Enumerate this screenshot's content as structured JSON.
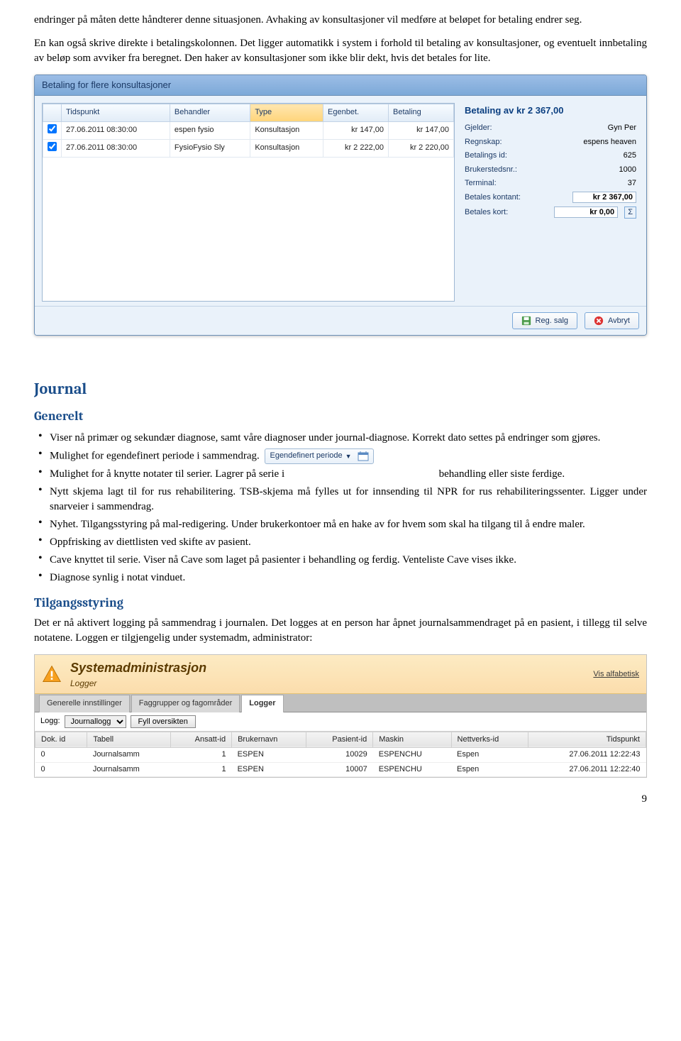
{
  "para1": "endringer på måten dette håndterer denne situasjonen. Avhaking av konsultasjoner vil medføre at beløpet for betaling endrer seg.",
  "para2": "En kan også skrive direkte i betalingskolonnen.",
  "para3": "Det ligger automatikk i system i forhold til betaling av konsultasjoner, og eventuelt innbetaling av beløp som avviker fra beregnet. Den haker av konsultasjoner som ikke blir dekt, hvis det betales for lite.",
  "dialog": {
    "title": "Betaling for flere konsultasjoner",
    "cols": {
      "tids": "Tidspunkt",
      "beh": "Behandler",
      "type": "Type",
      "egen": "Egenbet.",
      "bet": "Betaling"
    },
    "rows": [
      {
        "tids": "27.06.2011 08:30:00",
        "beh": "espen fysio",
        "type": "Konsultasjon",
        "egen": "kr 147,00",
        "bet": "kr 147,00"
      },
      {
        "tids": "27.06.2011 08:30:00",
        "beh": "FysioFysio Sly",
        "type": "Konsultasjon",
        "egen": "kr 2 222,00",
        "bet": "kr 2 220,00"
      }
    ],
    "side": {
      "title": "Betaling av kr 2 367,00",
      "gjelder_k": "Gjelder:",
      "gjelder_v": "Gyn Per",
      "regnskap_k": "Regnskap:",
      "regnskap_v": "espens heaven",
      "betid_k": "Betalings id:",
      "betid_v": "625",
      "bruker_k": "Brukerstedsnr.:",
      "bruker_v": "1000",
      "term_k": "Terminal:",
      "term_v": "37",
      "kontant_k": "Betales kontant:",
      "kontant_v": "kr 2 367,00",
      "kort_k": "Betales kort:",
      "kort_v": "kr 0,00"
    },
    "footer": {
      "reg": "Reg. salg",
      "avbryt": "Avbryt"
    }
  },
  "journal": {
    "heading": "Journal",
    "generelt": "Generelt",
    "b1a": "Viser nå primær og sekundær diagnose, samt våre diagnoser under journal-diagnose. Korrekt dato settes på endringer som gjøres.",
    "b2": "Mulighet for egendefinert periode i sammendrag.",
    "eg_label": "Egendefinert periode",
    "b3a": "Mulighet for å knytte notater til serier. Lagrer på serie i",
    "b3b": "behandling eller siste ferdige.",
    "b4": "Nytt skjema lagt til for rus rehabilitering. TSB-skjema må fylles ut for innsending til NPR for rus rehabiliteringssenter. Ligger under snarveier i sammendrag.",
    "b5": "Nyhet. Tilgangsstyring på mal-redigering. Under brukerkontoer må en hake av for hvem som skal ha tilgang til å endre maler.",
    "b6": "Oppfrisking av diettlisten ved skifte av pasient.",
    "b7": "Cave knyttet til serie. Viser nå Cave som laget på pasienter i behandling og ferdig. Venteliste Cave vises ikke.",
    "b8": "Diagnose synlig i notat vinduet."
  },
  "tilgang": {
    "heading": "Tilgangsstyring",
    "p": "Det er nå aktivert logging på sammendrag i journalen. Det logges at en person har åpnet journalsammendraget på en pasient, i tillegg til selve notatene. Loggen er tilgjengelig under systemadm, administrator:"
  },
  "sysadm": {
    "title": "Systemadministrasjon",
    "subtitle": "Logger",
    "vis": "Vis alfabetisk",
    "tabs": [
      "Generelle innstillinger",
      "Faggrupper og fagområder",
      "Logger"
    ],
    "logg_label": "Logg:",
    "logg_value": "Journallogg",
    "fyll": "Fyll oversikten",
    "cols": {
      "dok": "Dok. id",
      "tab": "Tabell",
      "ans": "Ansatt-id",
      "brk": "Brukernavn",
      "pas": "Pasient-id",
      "mask": "Maskin",
      "net": "Nettverks-id",
      "tid": "Tidspunkt"
    },
    "rows": [
      {
        "dok": "0",
        "tab": "Journalsamm",
        "ans": "1",
        "brk": "ESPEN",
        "pas": "10029",
        "mask": "ESPENCHU",
        "net": "Espen",
        "tid": "27.06.2011 12:22:43"
      },
      {
        "dok": "0",
        "tab": "Journalsamm",
        "ans": "1",
        "brk": "ESPEN",
        "pas": "10007",
        "mask": "ESPENCHU",
        "net": "Espen",
        "tid": "27.06.2011 12:22:40"
      }
    ]
  },
  "pagenum": "9"
}
